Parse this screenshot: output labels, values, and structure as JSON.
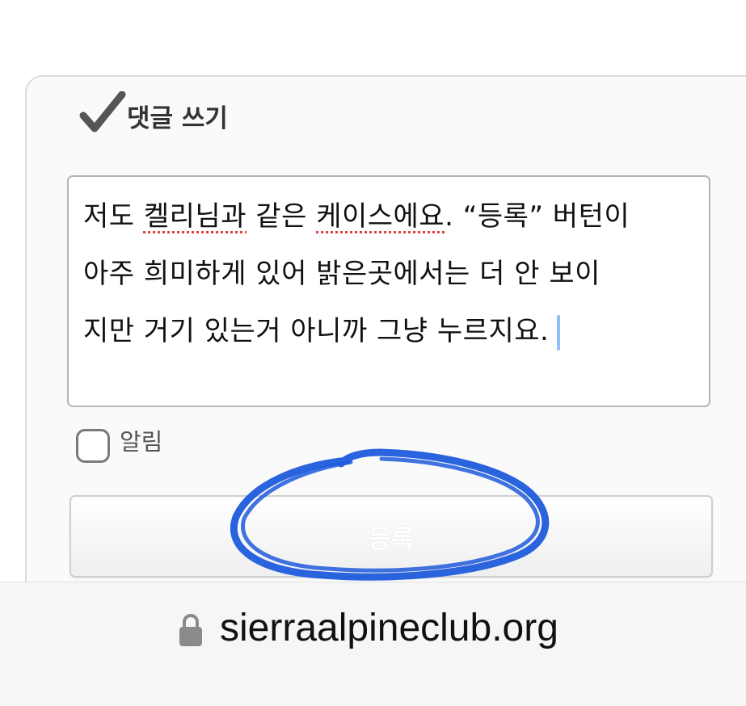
{
  "comment_form": {
    "title": "댓글 쓰기",
    "text_lines": [
      {
        "before": "저도 ",
        "misspelled": "켈리님과",
        "middle": " 같은 ",
        "misspelled2": "케이스에요",
        "after": ". “등록” 버턴이"
      },
      {
        "text": "아주 희미하게 있어 밝은곳에서는 더 안 보이"
      },
      {
        "text": "지만 거기 있는거 아니까 그냥 누르지요."
      }
    ],
    "notify_label": "알림",
    "notify_checked": false,
    "submit_label": "등록"
  },
  "browser": {
    "url": "sierraalpineclub.org"
  },
  "colors": {
    "annotation_stroke": "#1f5bdc",
    "caret": "#8ec0f7",
    "spellcheck": "#e0413a"
  },
  "icons": {
    "title_icon": "checkmark-icon",
    "url_icon": "lock-icon"
  }
}
